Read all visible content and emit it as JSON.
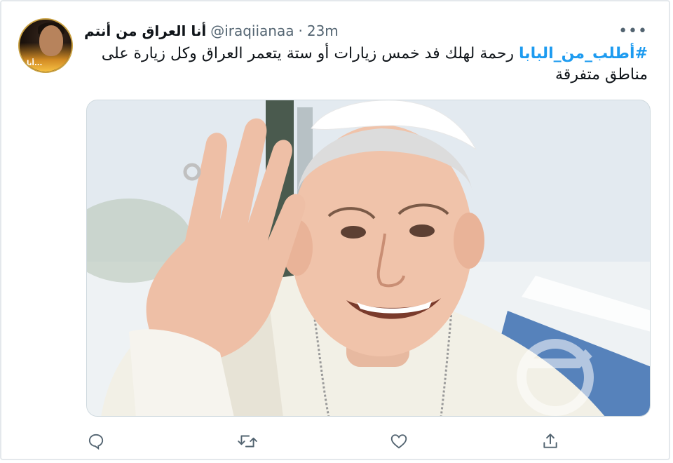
{
  "tweet": {
    "display_name": "أنا العراق من أنتم",
    "handle": "@iraqiianaa",
    "separator": "·",
    "time": "23m",
    "more_label": "•••",
    "hashtag": "#أطلب_من_البابا",
    "body_text": " رحمة لهلك فد خمس زيارات  أو ستة يتعمر العراق وكل زيارة على مناطق متفرقة",
    "avatar_badge": "أنا..."
  },
  "media": {
    "description_icon": "photo",
    "watermark_icon": "circle-logo"
  },
  "actions": {
    "reply_icon": "reply-icon",
    "retweet_icon": "retweet-icon",
    "like_icon": "heart-icon",
    "share_icon": "share-icon"
  },
  "colors": {
    "accent": "#1d9bf0",
    "text": "#0f1419",
    "secondary": "#536471"
  }
}
